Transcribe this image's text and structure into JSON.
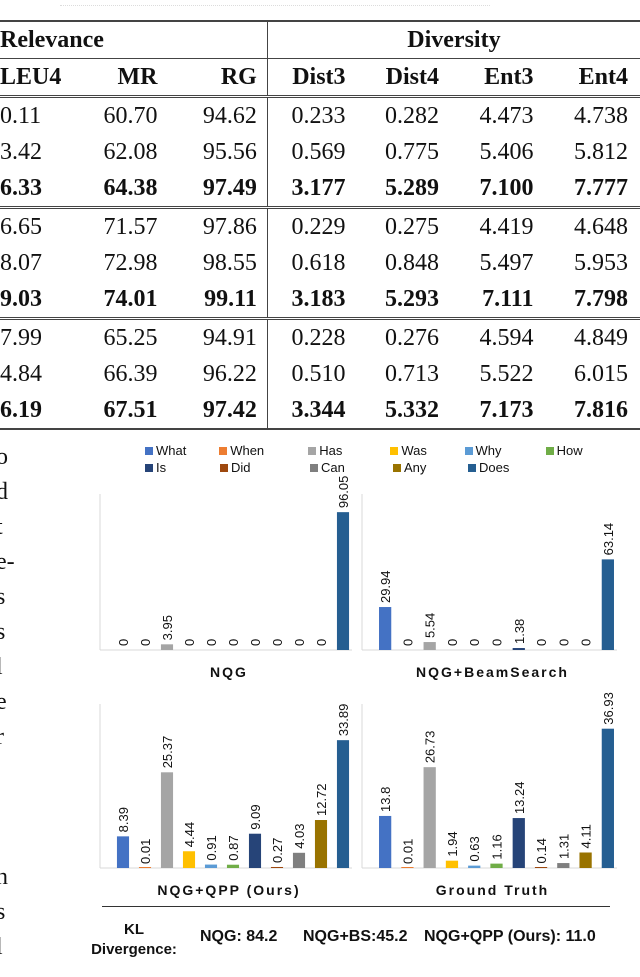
{
  "table": {
    "group_headers": {
      "relevance": "Relevance",
      "diversity": "Diversity"
    },
    "columns": [
      "LEU4",
      "MR",
      "RG",
      "Dist3",
      "Dist4",
      "Ent3",
      "Ent4"
    ],
    "rows": [
      {
        "bold": false,
        "cells": [
          "0.11",
          "60.70",
          "94.62",
          "0.233",
          "0.282",
          "4.473",
          "4.738"
        ]
      },
      {
        "bold": false,
        "cells": [
          "3.42",
          "62.08",
          "95.56",
          "0.569",
          "0.775",
          "5.406",
          "5.812"
        ]
      },
      {
        "bold": true,
        "cells": [
          "6.33",
          "64.38",
          "97.49",
          "3.177",
          "5.289",
          "7.100",
          "7.777"
        ]
      },
      {
        "bold": false,
        "cells": [
          "6.65",
          "71.57",
          "97.86",
          "0.229",
          "0.275",
          "4.419",
          "4.648"
        ]
      },
      {
        "bold": false,
        "cells": [
          "8.07",
          "72.98",
          "98.55",
          "0.618",
          "0.848",
          "5.497",
          "5.953"
        ]
      },
      {
        "bold": true,
        "cells": [
          "9.03",
          "74.01",
          "99.11",
          "3.183",
          "5.293",
          "7.111",
          "7.798"
        ]
      },
      {
        "bold": false,
        "cells": [
          "7.99",
          "65.25",
          "94.91",
          "0.228",
          "0.276",
          "4.594",
          "4.849"
        ]
      },
      {
        "bold": false,
        "cells": [
          "4.84",
          "66.39",
          "96.22",
          "0.510",
          "0.713",
          "5.522",
          "6.015"
        ]
      },
      {
        "bold": true,
        "cells": [
          "6.19",
          "67.51",
          "97.42",
          "3.344",
          "5.332",
          "7.173",
          "7.816"
        ]
      }
    ]
  },
  "left_column_fragments": [
    "o",
    "d",
    "t",
    "e-",
    "s",
    "s",
    "l",
    "e",
    "r",
    "",
    "",
    "",
    "n",
    "s",
    "l"
  ],
  "legend": [
    {
      "label": "What",
      "color": "#4472c4"
    },
    {
      "label": "When",
      "color": "#ed7d31"
    },
    {
      "label": "Has",
      "color": "#a5a5a5"
    },
    {
      "label": "Was",
      "color": "#ffc000"
    },
    {
      "label": "Why",
      "color": "#5b9bd5"
    },
    {
      "label": "How",
      "color": "#70ad47"
    },
    {
      "label": "Is",
      "color": "#264478"
    },
    {
      "label": "Did",
      "color": "#9e480e"
    },
    {
      "label": "Can",
      "color": "#7f7f7f"
    },
    {
      "label": "Any",
      "color": "#997300"
    },
    {
      "label": "Does",
      "color": "#255e91"
    }
  ],
  "chart_data": [
    {
      "type": "bar",
      "title": "NQG",
      "categories": [
        "What",
        "When",
        "Has",
        "Was",
        "Why",
        "How",
        "Is",
        "Did",
        "Can",
        "Any",
        "Does"
      ],
      "values": [
        0,
        0,
        3.95,
        0,
        0,
        0,
        0,
        0,
        0,
        0,
        96.05
      ],
      "labels": [
        "0",
        "0",
        "3.95",
        "0",
        "0",
        "0",
        "0",
        "0",
        "0",
        "0",
        "96.05"
      ],
      "ylim": [
        0,
        100
      ]
    },
    {
      "type": "bar",
      "title": "NQG+BeamSearch",
      "categories": [
        "What",
        "When",
        "Has",
        "Was",
        "Why",
        "How",
        "Is",
        "Did",
        "Can",
        "Any",
        "Does"
      ],
      "values": [
        29.94,
        0,
        5.54,
        0,
        0,
        0,
        1.38,
        0,
        0,
        0,
        63.14
      ],
      "labels": [
        "29.94",
        "0",
        "5.54",
        "0",
        "0",
        "0",
        "1.38",
        "0",
        "0",
        "0",
        "63.14"
      ],
      "ylim": [
        0,
        100
      ]
    },
    {
      "type": "bar",
      "title": "NQG+QPP (Ours)",
      "categories": [
        "What",
        "When",
        "Has",
        "Was",
        "Why",
        "How",
        "Is",
        "Did",
        "Can",
        "Any",
        "Does"
      ],
      "values": [
        8.39,
        0.01,
        25.37,
        4.44,
        0.91,
        0.87,
        9.09,
        0.27,
        4.03,
        12.72,
        33.89
      ],
      "labels": [
        "8.39",
        "0.01",
        "25.37",
        "4.44",
        "0.91",
        "0.87",
        "9.09",
        "0.27",
        "4.03",
        "12.72",
        "33.89"
      ],
      "ylim": [
        0,
        40
      ]
    },
    {
      "type": "bar",
      "title": "Ground Truth",
      "categories": [
        "What",
        "When",
        "Has",
        "Was",
        "Why",
        "How",
        "Is",
        "Did",
        "Can",
        "Any",
        "Does"
      ],
      "values": [
        13.8,
        0.01,
        26.73,
        1.94,
        0.63,
        1.16,
        13.24,
        0.14,
        1.31,
        4.11,
        36.93
      ],
      "labels": [
        "13.8",
        "0.01",
        "26.73",
        "1.94",
        "0.63",
        "1.16",
        "13.24",
        "0.14",
        "1.31",
        "4.11",
        "36.93"
      ],
      "ylim": [
        0,
        40
      ]
    }
  ],
  "kl": {
    "label_line1": "KL",
    "label_line2": "Divergence:",
    "nqg": "NQG: 84.2",
    "bs": "NQG+BS:45.2",
    "qpp": "NQG+QPP (Ours): 11.0"
  }
}
